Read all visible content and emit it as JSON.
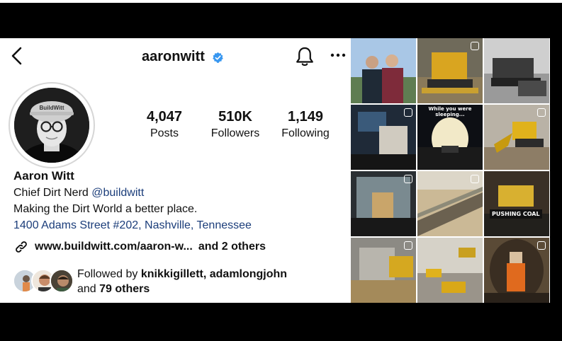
{
  "profile": {
    "username": "aaronwitt",
    "stats": {
      "posts_count": "4,047",
      "posts_label": "Posts",
      "followers_count": "510K",
      "followers_label": "Followers",
      "following_count": "1,149",
      "following_label": "Following"
    },
    "name": "Aaron Witt",
    "bio_prefix": "Chief Dirt Nerd ",
    "bio_handle": "@buildwitt",
    "bio_line2": "Making the Dirt World a better place.",
    "address": "1400 Adams Street #202, Nashville, Tennessee",
    "link_text": "www.buildwitt.com/aaron-w...",
    "link_others": "and 2 others",
    "followed_by_prefix": "Followed by ",
    "followed_by_names": "knikkigillett, adamlongjohn",
    "followed_by_and": "and ",
    "followed_by_others": "79 others",
    "avatar_hat_text": "BuildWitt"
  },
  "icons": {
    "back": "chevron-left-icon",
    "verified": "verified-badge-icon",
    "bell": "bell-icon",
    "more": "more-horizontal-icon",
    "link": "link-icon"
  },
  "colors": {
    "verified_blue": "#3897f0",
    "link_blue": "#1b3d7a"
  },
  "grid": {
    "captions": {
      "post_5": "While you were sleeping...",
      "post_9": "PUSHING COAL"
    }
  }
}
